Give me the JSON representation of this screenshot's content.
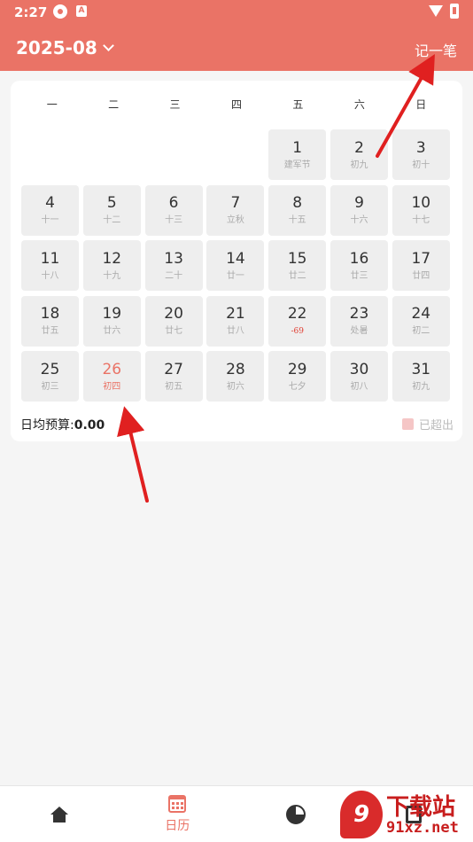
{
  "status_bar": {
    "time": "2:27",
    "notification_icons": [
      "app-icon",
      "a-icon"
    ],
    "system_icons": [
      "wifi-icon",
      "battery-icon"
    ]
  },
  "header": {
    "month": "2025-08",
    "record_label": "记一笔",
    "background_color": "#ea7366"
  },
  "calendar": {
    "weekdays": [
      "一",
      "二",
      "三",
      "四",
      "五",
      "六",
      "日"
    ],
    "leading_blanks": 4,
    "days": [
      {
        "day": "1",
        "sub": "建军节"
      },
      {
        "day": "2",
        "sub": "初九"
      },
      {
        "day": "3",
        "sub": "初十"
      },
      {
        "day": "4",
        "sub": "十一"
      },
      {
        "day": "5",
        "sub": "十二"
      },
      {
        "day": "6",
        "sub": "十三"
      },
      {
        "day": "7",
        "sub": "立秋"
      },
      {
        "day": "8",
        "sub": "十五"
      },
      {
        "day": "9",
        "sub": "十六"
      },
      {
        "day": "10",
        "sub": "十七"
      },
      {
        "day": "11",
        "sub": "十八"
      },
      {
        "day": "12",
        "sub": "十九"
      },
      {
        "day": "13",
        "sub": "二十"
      },
      {
        "day": "14",
        "sub": "廿一"
      },
      {
        "day": "15",
        "sub": "廿二"
      },
      {
        "day": "16",
        "sub": "廿三"
      },
      {
        "day": "17",
        "sub": "廿四"
      },
      {
        "day": "18",
        "sub": "廿五"
      },
      {
        "day": "19",
        "sub": "廿六"
      },
      {
        "day": "20",
        "sub": "廿七"
      },
      {
        "day": "21",
        "sub": "廿八"
      },
      {
        "day": "22",
        "sub": "",
        "amount": "-69"
      },
      {
        "day": "23",
        "sub": "处暑"
      },
      {
        "day": "24",
        "sub": "初二"
      },
      {
        "day": "25",
        "sub": "初三"
      },
      {
        "day": "26",
        "sub": "初四",
        "today": true
      },
      {
        "day": "27",
        "sub": "初五"
      },
      {
        "day": "28",
        "sub": "初六"
      },
      {
        "day": "29",
        "sub": "七夕"
      },
      {
        "day": "30",
        "sub": "初八"
      },
      {
        "day": "31",
        "sub": "初九"
      }
    ]
  },
  "budget": {
    "label": "日均预算:",
    "value": "0.00"
  },
  "legend": {
    "label": "已超出",
    "color": "#f5c6c6"
  },
  "bottom_nav": {
    "items": [
      {
        "icon": "home-icon",
        "label": ""
      },
      {
        "icon": "calendar-icon",
        "label": "日历",
        "active": true
      },
      {
        "icon": "pie-chart-icon",
        "label": ""
      },
      {
        "icon": "ledger-icon",
        "label": ""
      }
    ]
  },
  "watermark": {
    "logo": "9",
    "title": "下载站",
    "url": "91xz.net"
  },
  "accent_color": "#ea7366",
  "annotation_arrow_color": "#e02020"
}
